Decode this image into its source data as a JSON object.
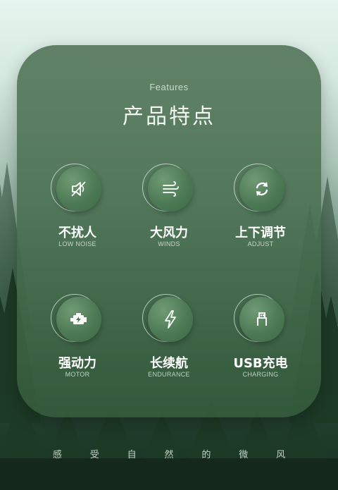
{
  "header": {
    "features_en": "Features",
    "features_zh": "产品特点"
  },
  "features": [
    {
      "zh": "不扰人",
      "en": "LOW NOISE",
      "icon": "mute-icon"
    },
    {
      "zh": "大风力",
      "en": "WINDS",
      "icon": "wind-icon"
    },
    {
      "zh": "上下调节",
      "en": "ADJUST",
      "icon": "rotate-icon"
    },
    {
      "zh": "强动力",
      "en": "MOTOR",
      "icon": "motor-icon"
    },
    {
      "zh": "长续航",
      "en": "ENDURANCE",
      "icon": "lightning-icon"
    },
    {
      "zh": "USB充电",
      "en": "CHARGING",
      "icon": "usb-icon"
    }
  ],
  "slogan": [
    "感",
    "受",
    "自",
    "然",
    "的",
    "微",
    "风"
  ],
  "colors": {
    "card": "#56785c",
    "icon_circle": "#4d7a55",
    "text": "#ffffff"
  }
}
